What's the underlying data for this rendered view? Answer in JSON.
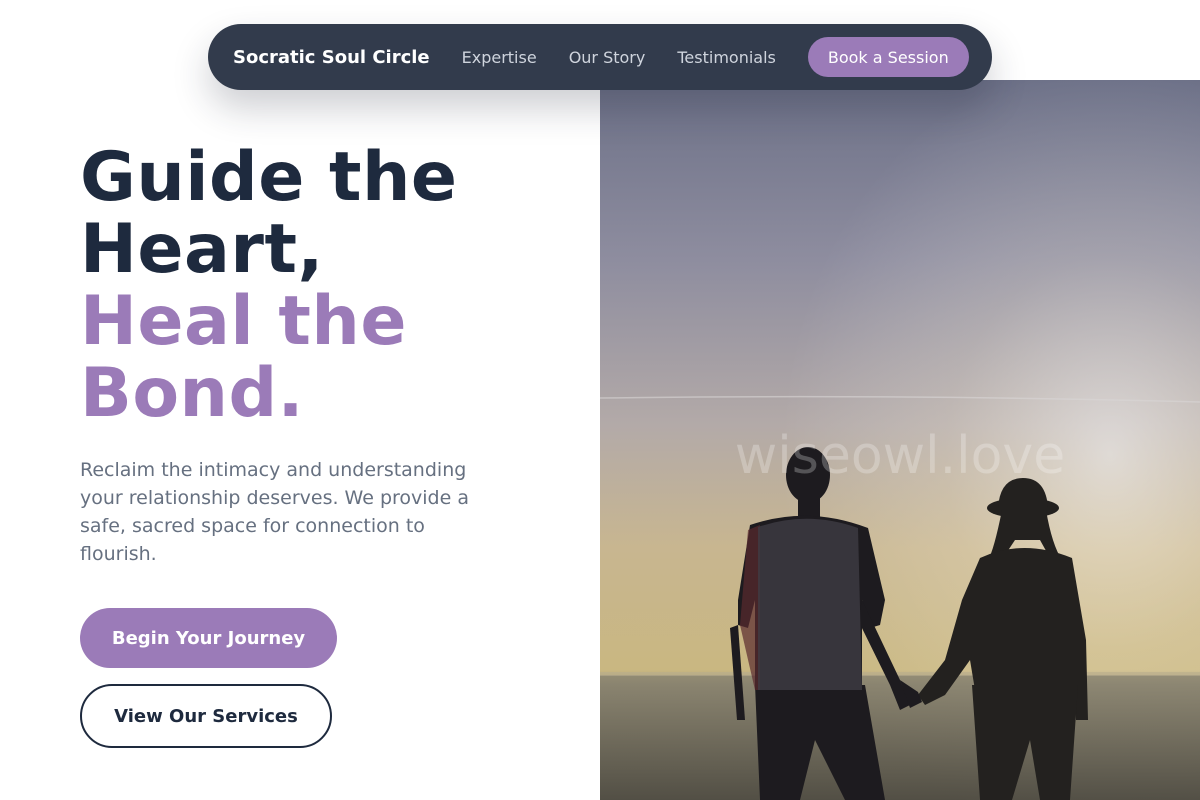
{
  "nav": {
    "brand": "Socratic Soul Circle",
    "links": [
      "Expertise",
      "Our Story",
      "Testimonials"
    ],
    "cta": "Book a Session"
  },
  "hero": {
    "headline_line1": "Guide the",
    "headline_line2": "Heart,",
    "headline_line3": "Heal the",
    "headline_line4": "Bond.",
    "lead": "Reclaim the intimacy and understanding your relationship deserves. We provide a safe, sacred space for connection to flourish.",
    "primary_button": "Begin Your Journey",
    "secondary_button": "View Our Services",
    "image_watermark": "wiseowl.love"
  },
  "colors": {
    "accent": "#9b7bb8",
    "dark": "#1e2a3e",
    "nav_bg": "#323b4c",
    "muted_text": "#667080"
  }
}
